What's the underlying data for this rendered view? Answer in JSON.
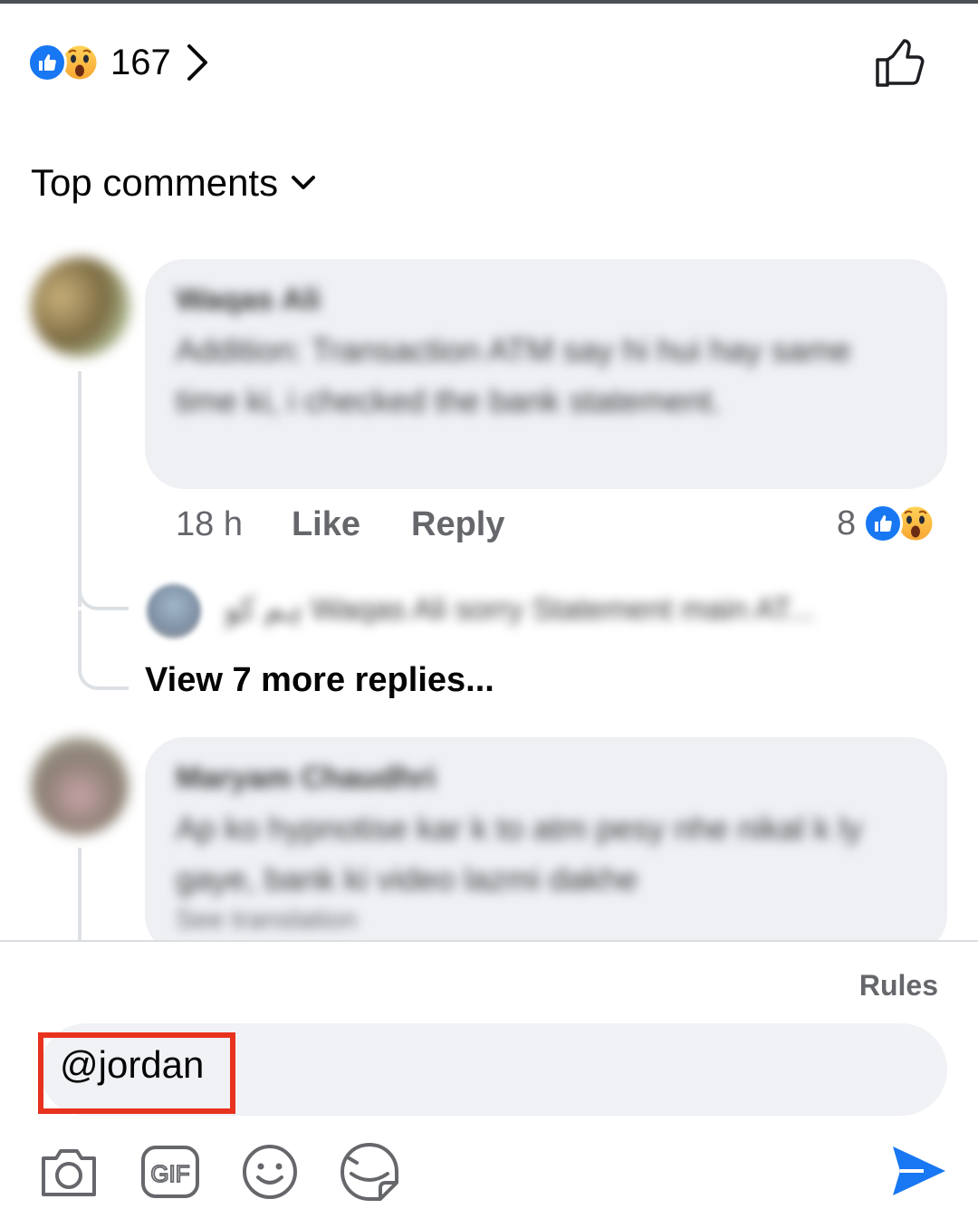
{
  "reactions": {
    "count": "167",
    "icons": [
      "like-icon",
      "wow-icon"
    ]
  },
  "sort": {
    "label": "Top comments"
  },
  "comments": [
    {
      "author": "Waqas Ali",
      "text": "Addition: Transaction ATM say hi hui hay same time ki, i checked the bank statement.",
      "time": "18 h",
      "like_label": "Like",
      "reply_label": "Reply",
      "reaction_count": "8",
      "reply_preview": "ہم کو Waqas Ali sorry Statement main AT...",
      "view_more": "View 7 more replies..."
    },
    {
      "author": "Maryam Chaudhri",
      "text": "Ap ko hypnotise kar k to atm pesy nhe nikal k ly gaye, bank ki video lazmi dakhe",
      "see_translation": "See translation"
    }
  ],
  "composer": {
    "rules_label": "Rules",
    "input_value": "@jordan",
    "tools": [
      "camera-icon",
      "gif-icon",
      "emoji-icon",
      "sticker-icon"
    ],
    "send_icon": "send-icon"
  },
  "colors": {
    "accent": "#1877f2",
    "highlight": "#e8321e",
    "bubble": "#eef0f4",
    "muted_text": "#65676b"
  }
}
